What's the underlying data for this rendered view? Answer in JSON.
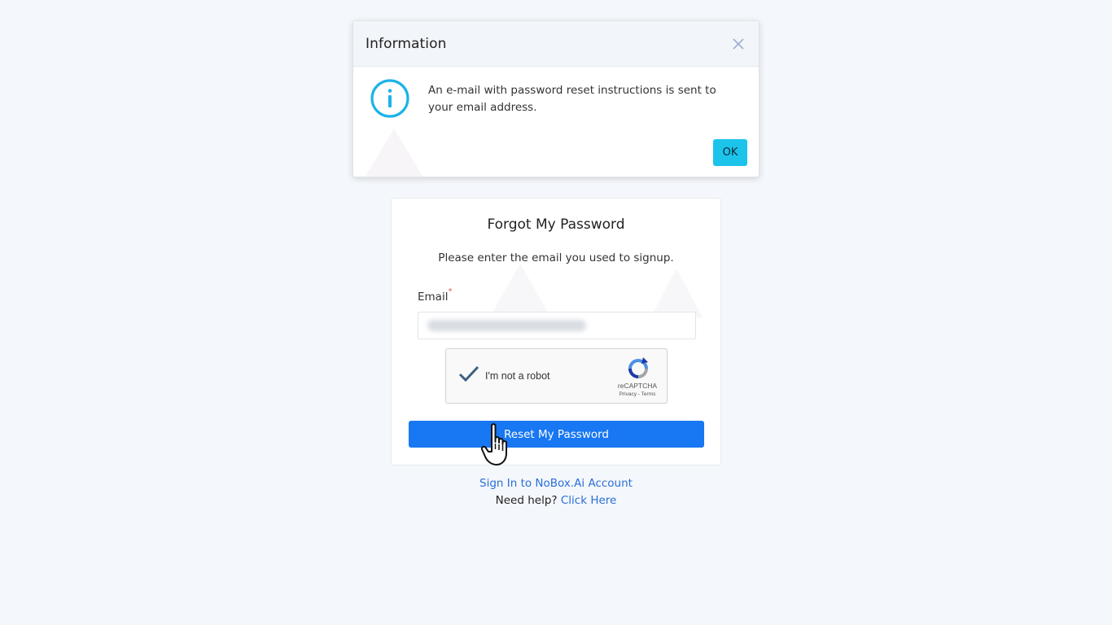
{
  "modal": {
    "title": "Information",
    "close_icon": "close-icon",
    "info_icon": "info-circle-icon",
    "message": "An e-mail with password reset instructions is sent to your email address.",
    "ok_label": "OK"
  },
  "form": {
    "title": "Forgot My Password",
    "subtitle": "Please enter the email you used to signup.",
    "email_label": "Email",
    "required_marker": "*",
    "email_value": "",
    "recaptcha": {
      "checkbox_label": "I'm not a robot",
      "brand": "reCAPTCHA",
      "links": "Privacy - Terms",
      "checked": true
    },
    "submit_label": "Reset My Password"
  },
  "footer": {
    "sign_in_link": "Sign In to NoBox.Ai Account",
    "help_text": "Need help?",
    "help_link": "Click Here"
  },
  "colors": {
    "accent": "#1877f2",
    "info": "#1cc4ec",
    "link": "#2a6fd6",
    "background": "#f4f7fb"
  }
}
